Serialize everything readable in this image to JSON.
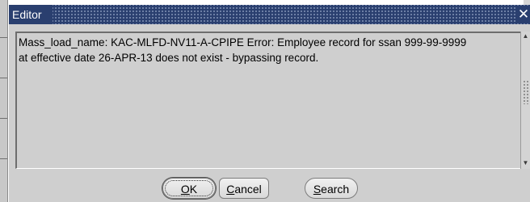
{
  "window": {
    "title": "Editor",
    "close_symbol": "✕"
  },
  "editor": {
    "text": "Mass_load_name: KAC-MLFD-NV11-A-CPIPE Error: Employee record for ssan 999-99-9999\nat effective date 26-APR-13 does not exist - bypassing record."
  },
  "buttons": {
    "ok": {
      "mnemonic": "O",
      "rest": "K"
    },
    "cancel": {
      "mnemonic": "C",
      "rest": "ancel"
    },
    "search": {
      "mnemonic": "S",
      "rest": "earch"
    }
  },
  "scrollbar": {
    "up_icon": "▲",
    "down_icon": "▼"
  },
  "colors": {
    "titlebar": "#2a3f6f",
    "dialog_bg": "#cfcfcf"
  }
}
